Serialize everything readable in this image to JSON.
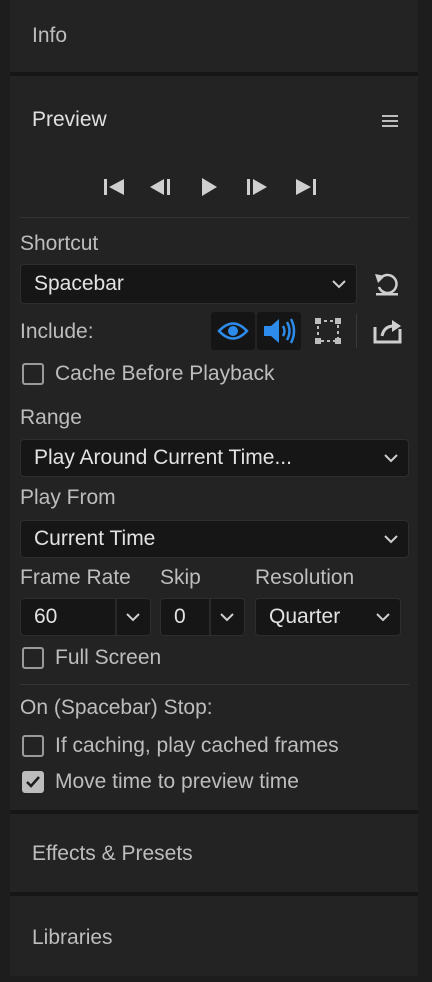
{
  "panels": {
    "info": "Info",
    "preview": "Preview",
    "effects": "Effects & Presets",
    "libraries": "Libraries"
  },
  "shortcut": {
    "label": "Shortcut",
    "value": "Spacebar"
  },
  "include": {
    "label": "Include:"
  },
  "cache_before_playback": {
    "label": "Cache Before Playback",
    "checked": false
  },
  "range": {
    "label": "Range",
    "value": "Play Around Current Time..."
  },
  "play_from": {
    "label": "Play From",
    "value": "Current Time"
  },
  "frame_rate": {
    "label": "Frame Rate",
    "value": "60"
  },
  "skip": {
    "label": "Skip",
    "value": "0"
  },
  "resolution": {
    "label": "Resolution",
    "value": "Quarter"
  },
  "full_screen": {
    "label": "Full Screen",
    "checked": false
  },
  "stop": {
    "label": "On (Spacebar) Stop:",
    "if_caching": {
      "label": "If caching, play cached frames",
      "checked": false
    },
    "move_time": {
      "label": "Move time to preview time",
      "checked": true
    }
  },
  "colors": {
    "accent": "#2d8ceb",
    "panel": "#232323",
    "field": "#161616"
  },
  "icons": [
    "first-frame-icon",
    "previous-frame-icon",
    "play-icon",
    "next-frame-icon",
    "last-frame-icon",
    "panel-menu-icon",
    "reset-icon",
    "video-eye-icon",
    "audio-speaker-icon",
    "overlays-icon",
    "export-icon",
    "chevron-down-icon",
    "checkmark-icon"
  ]
}
